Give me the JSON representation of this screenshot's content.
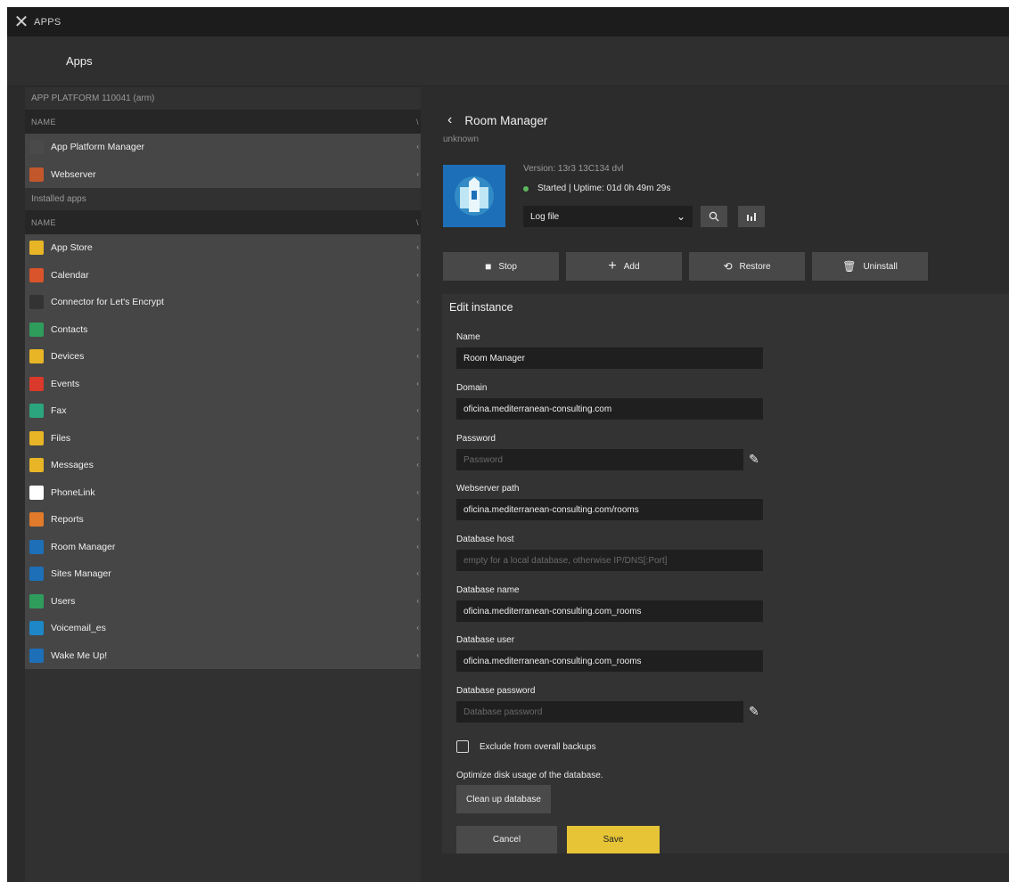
{
  "window": {
    "title": "APPS"
  },
  "header": {
    "title": "Apps"
  },
  "left": {
    "platform_label": "APP PLATFORM 110041 (arm)",
    "column_name": "NAME",
    "platform_items": [
      {
        "label": "App Platform Manager",
        "icon": "gear-grid-icon",
        "color": "#4a4a4a"
      },
      {
        "label": "Webserver",
        "icon": "webserver-icon",
        "color": "#c2572b"
      }
    ],
    "installed_label": "Installed apps",
    "installed_column_name": "NAME",
    "installed_items": [
      {
        "label": "App Store",
        "icon": "cart-icon",
        "color": "#e7b526"
      },
      {
        "label": "Calendar",
        "icon": "calendar-icon",
        "color": "#d9532b"
      },
      {
        "label": "Connector for Let's Encrypt",
        "icon": "lock-icon",
        "color": "#333333"
      },
      {
        "label": "Contacts",
        "icon": "contacts-icon",
        "color": "#2e9d5c"
      },
      {
        "label": "Devices",
        "icon": "devices-icon",
        "color": "#e7b526"
      },
      {
        "label": "Events",
        "icon": "events-icon",
        "color": "#d93a2b"
      },
      {
        "label": "Fax",
        "icon": "fax-icon",
        "color": "#2aa57d"
      },
      {
        "label": "Files",
        "icon": "files-icon",
        "color": "#e7b526"
      },
      {
        "label": "Messages",
        "icon": "messages-icon",
        "color": "#e7b526"
      },
      {
        "label": "PhoneLink",
        "icon": "phonelink-icon",
        "color": "#ffffff"
      },
      {
        "label": "Reports",
        "icon": "reports-icon",
        "color": "#e17a2a"
      },
      {
        "label": "Room Manager",
        "icon": "room-manager-icon",
        "color": "#1d6fb8"
      },
      {
        "label": "Sites Manager",
        "icon": "sites-icon",
        "color": "#1d6fb8"
      },
      {
        "label": "Users",
        "icon": "users-icon",
        "color": "#2e9d5c"
      },
      {
        "label": "Voicemail_es",
        "icon": "voicemail-icon",
        "color": "#1d87c8"
      },
      {
        "label": "Wake Me Up!",
        "icon": "wake-icon",
        "color": "#1d6fb8"
      }
    ]
  },
  "detail": {
    "back_glyph": "‹",
    "title": "Room Manager",
    "subtitle": "unknown",
    "version": "Version: 13r3 13C134 dvl",
    "status": "Started | Uptime: 01d 0h 49m 29s",
    "status_color": "#5cb85c",
    "log_select": "Log file",
    "buttons": {
      "stop": "Stop",
      "add": "Add",
      "restore": "Restore",
      "uninstall": "Uninstall"
    }
  },
  "edit": {
    "title": "Edit instance",
    "name_label": "Name",
    "name_value": "Room Manager",
    "domain_label": "Domain",
    "domain_value": "oficina.mediterranean-consulting.com",
    "password_label": "Password",
    "password_placeholder": "Password",
    "webserver_label": "Webserver path",
    "webserver_value": "oficina.mediterranean-consulting.com/rooms",
    "dbhost_label": "Database host",
    "dbhost_placeholder": "empty for a local database, otherwise IP/DNS[:Port]",
    "dbname_label": "Database name",
    "dbname_value": "oficina.mediterranean-consulting.com_rooms",
    "dbuser_label": "Database user",
    "dbuser_value": "oficina.mediterranean-consulting.com_rooms",
    "dbpass_label": "Database password",
    "dbpass_placeholder": "Database password",
    "exclude_label": "Exclude from overall backups",
    "optimize_text": "Optimize disk usage of the database.",
    "cleanup_label": "Clean up database",
    "cancel_label": "Cancel",
    "save_label": "Save",
    "save_color": "#e6c436"
  }
}
